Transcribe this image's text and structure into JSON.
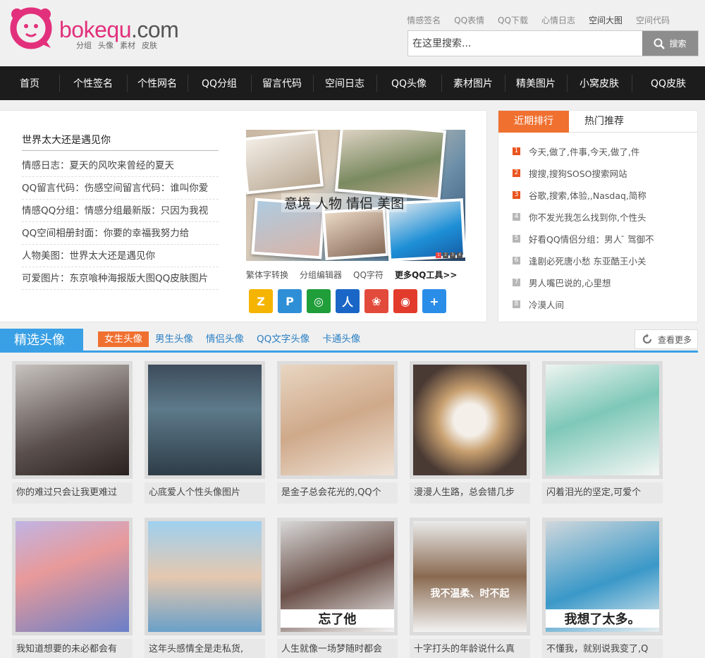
{
  "site": {
    "logo_text_main": "bokequ",
    "logo_text_dot": ".com",
    "logo_sub": [
      "分组",
      "头像",
      "素材",
      "皮肤"
    ]
  },
  "toplinks": [
    "情感签名",
    "QQ表情",
    "QQ下载",
    "心情日志",
    "空间大图",
    "空间代码"
  ],
  "search": {
    "placeholder": "在这里搜索...",
    "button": "搜索"
  },
  "nav": [
    "首页",
    "个性签名",
    "个性网名",
    "QQ分组",
    "留言代码",
    "空间日志",
    "QQ头像",
    "素材图片",
    "精美图片",
    "小窝皮肤",
    "QQ皮肤"
  ],
  "news": {
    "title": "世界太大还是遇见你",
    "items": [
      "情感日志：夏天的风吹来曾经的夏天",
      "QQ留言代码：伤感空间留言代码：谁叫你爱",
      "情感QQ分组：情感分组最新版：只因为我视",
      "QQ空间相册封面：你要的幸福我努力给",
      "人物美图：世界太大还是遇见你",
      "可爱图片：东京喰种海报版大图QQ皮肤图片"
    ]
  },
  "banner": {
    "caption": "意境 人物 情侣 美图",
    "dots": [
      "1",
      "2",
      "3",
      "4"
    ]
  },
  "tools": [
    "繁体字转换",
    "分组编辑器",
    "QQ字符",
    "更多QQ工具>>"
  ],
  "apps": [
    {
      "name": "qq-space-app",
      "color": "#f5b400",
      "glyph": "Z"
    },
    {
      "name": "qq-search-app",
      "color": "#2e8fd6",
      "glyph": "P"
    },
    {
      "name": "qq-music-app",
      "color": "#1f9e3a",
      "glyph": "◎"
    },
    {
      "name": "renren-app",
      "color": "#1a66c7",
      "glyph": "人"
    },
    {
      "name": "qq-pet-app",
      "color": "#e24b3b",
      "glyph": "❀"
    },
    {
      "name": "weibo-app",
      "color": "#e23b2b",
      "glyph": "◉"
    },
    {
      "name": "add-more-app",
      "color": "#2a8ee8",
      "glyph": "+"
    }
  ],
  "rank": {
    "tabs": [
      "近期排行",
      "热门推荐"
    ],
    "items": [
      {
        "num": "1",
        "text": "今天,做了,件事,今天,做了,件"
      },
      {
        "num": "2",
        "text": "搜搜,搜狗SOSO搜索网站"
      },
      {
        "num": "3",
        "text": "谷歌,搜索,体验,,Nasdaq,简称"
      },
      {
        "num": "4",
        "text": "你不发光我怎么找到你,个性头"
      },
      {
        "num": "5",
        "text": "好看QQ情侣分组：男人 ̄ 驾御不"
      },
      {
        "num": "6",
        "text": "逢剧必死唐小愁 东亚酷王小关"
      },
      {
        "num": "7",
        "text": "男人嘴巴说的,心里想"
      },
      {
        "num": "8",
        "text": "冷漠人间"
      }
    ]
  },
  "section": {
    "title": "精选头像",
    "tabs": [
      "女生头像",
      "男生头像",
      "情侣头像",
      "QQ文字头像",
      "卡通头像"
    ],
    "more": "查看更多"
  },
  "cards": [
    {
      "caption": "你的难过只会让我更难过",
      "bg": "linear-gradient(160deg,#c8c3c0,#5a4f4c 60%,#2a2220)"
    },
    {
      "caption": "心底爱人个性头像图片",
      "bg": "linear-gradient(180deg,#3d4c5c,#5d7a8a 40%,#2e3d48)"
    },
    {
      "caption": "是金子总会花光的,QQ个",
      "bg": "linear-gradient(160deg,#e8d6c2,#cfa98a 50%,#f0e4d8)"
    },
    {
      "caption": "漫漫人生路，总会错几步",
      "bg": "radial-gradient(circle at 50% 50%,#f4efe8 20%,#c8a070 40%,#4a3a34 75%)"
    },
    {
      "caption": "闪着泪光的坚定,可爱个",
      "bg": "linear-gradient(160deg,#eef4f0,#7ec8b8 45%,#f4f6f4)"
    },
    {
      "caption": "我知道想要的未必都会有",
      "bg": "linear-gradient(160deg,#c0b4e4,#e89a9a 40%,#6a7fc8)"
    },
    {
      "caption": "这年头感情全是走私货,",
      "bg": "linear-gradient(180deg,#9fd0ef,#e4c8b0 50%,#6aa0c8)"
    },
    {
      "caption": "人生就像一场梦随时都会",
      "bg": "linear-gradient(160deg,#d8d8d8,#6a5048 50%,#f4f4f4)",
      "overlay": "忘了他"
    },
    {
      "caption": "十字打头的年龄说什么真",
      "bg": "linear-gradient(180deg,#eaeaea,#8a6a50 50%,#f2f2f2)",
      "overlay": "我不温柔、时不起"
    },
    {
      "caption": "不懂我，就别说我变了,Q",
      "bg": "linear-gradient(160deg,#d0d8dc,#3a98c8 55%,#e8eef0)",
      "overlay": "我想了太多。"
    }
  ]
}
